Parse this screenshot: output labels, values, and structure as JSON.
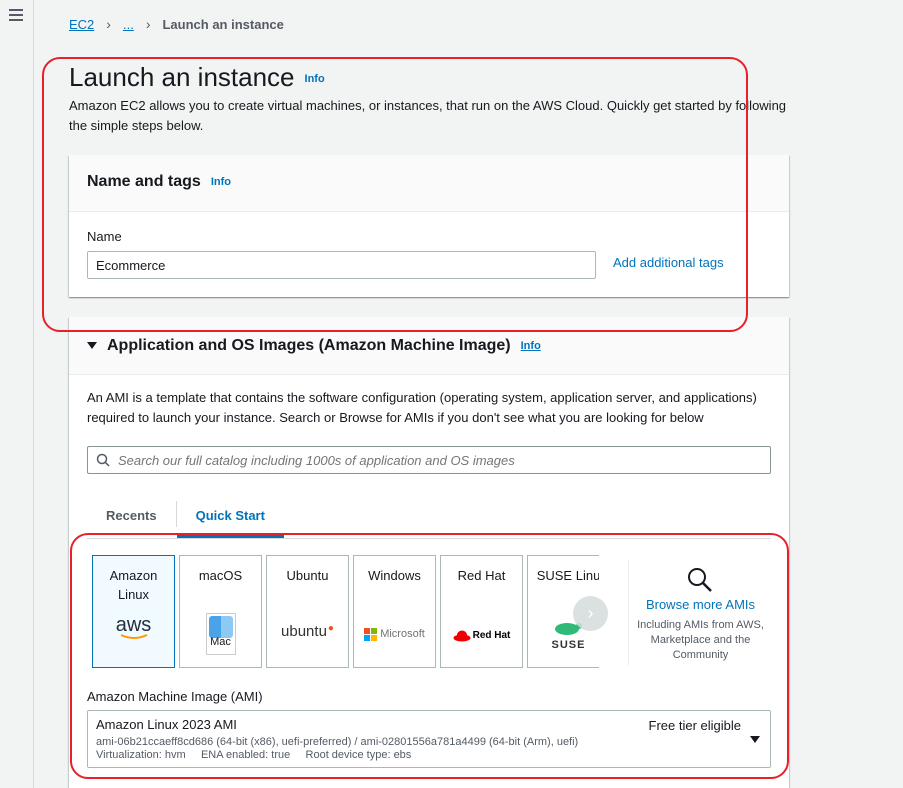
{
  "breadcrumb": {
    "root": "EC2",
    "ellipsis": "...",
    "current": "Launch an instance"
  },
  "page": {
    "title": "Launch an instance",
    "info": "Info",
    "description": "Amazon EC2 allows you to create virtual machines, or instances, that run on the AWS Cloud. Quickly get started by following the simple steps below."
  },
  "name_tags": {
    "title": "Name and tags",
    "info": "Info",
    "name_label": "Name",
    "name_value": "Ecommerce",
    "add_tags": "Add additional tags"
  },
  "ami": {
    "title": "Application and OS Images (Amazon Machine Image)",
    "info": "Info",
    "description": "An AMI is a template that contains the software configuration (operating system, application server, and applications) required to launch your instance. Search or Browse for AMIs if you don't see what you are looking for below",
    "search_placeholder": "Search our full catalog including 1000s of application and OS images",
    "tabs": [
      "Recents",
      "Quick Start"
    ],
    "active_tab": "Quick Start",
    "os": [
      {
        "label": "Amazon Linux",
        "logo": "aws",
        "selected": true
      },
      {
        "label": "macOS",
        "logo": "Mac"
      },
      {
        "label": "Ubuntu",
        "logo": "ubuntu"
      },
      {
        "label": "Windows",
        "logo": "Microsoft"
      },
      {
        "label": "Red Hat",
        "logo": "Red Hat"
      },
      {
        "label": "SUSE Linu",
        "logo": "SUSE"
      }
    ],
    "browse_more": "Browse more AMIs",
    "browse_sub": "Including AMIs from AWS, Marketplace and the Community",
    "select_label": "Amazon Machine Image (AMI)",
    "selected_name": "Amazon Linux 2023 AMI",
    "selected_badge": "Free tier eligible",
    "selected_ids": "ami-06b21ccaeff8cd686 (64-bit (x86), uefi-preferred) / ami-02801556a781a4499 (64-bit (Arm), uefi)",
    "selected_meta": "Virtualization: hvm     ENA enabled: true     Root device type: ebs"
  },
  "colors": {
    "link": "#0073bb",
    "highlight": "#e8202a",
    "page_bg": "#f2f3f3"
  }
}
